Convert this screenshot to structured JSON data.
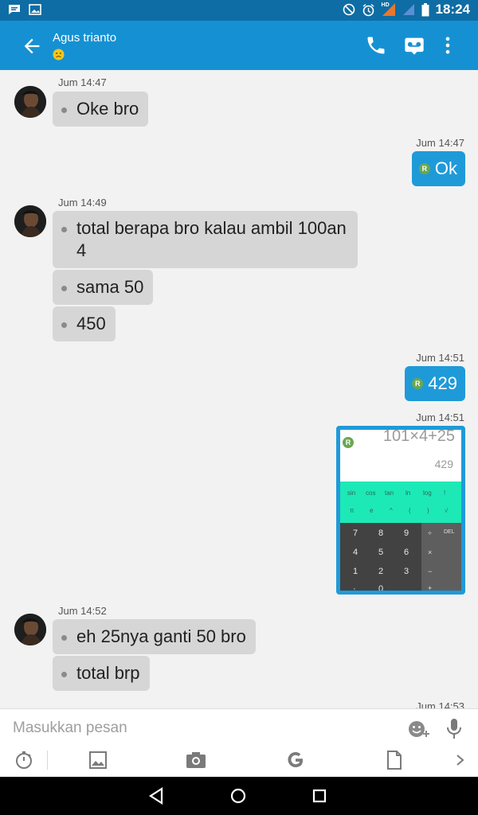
{
  "status_bar": {
    "time": "18:24",
    "network": "HD"
  },
  "header": {
    "contact_name": "Agus trianto",
    "status_icon": "sad-face-emoji",
    "accent": "#1591d3"
  },
  "messages": {
    "m1": {
      "time": "Jum 14:47",
      "text": "Oke bro"
    },
    "m2": {
      "time": "Jum 14:47",
      "text": "Ok",
      "badge": "R"
    },
    "m3": {
      "time": "Jum 14:49",
      "text1": "total berapa bro kalau ambil 100an 4",
      "text2": "sama 50",
      "text3": "450"
    },
    "m4": {
      "time": "Jum 14:51",
      "text": "429",
      "badge": "R"
    },
    "m5": {
      "time": "Jum 14:51",
      "badge": "R",
      "calc": {
        "expression": "101×4+25",
        "result": "429",
        "sci_row1": [
          "sin",
          "cos",
          "tan",
          "ln",
          "log",
          "!"
        ],
        "sci_row2": [
          "π",
          "e",
          "^",
          "(",
          ")",
          "√"
        ],
        "pad_row1": [
          "7",
          "8",
          "9"
        ],
        "pad_row2": [
          "4",
          "5",
          "6"
        ],
        "pad_row3": [
          "1",
          "2",
          "3"
        ],
        "pad_row4": [
          "·",
          "0"
        ],
        "ops": [
          "÷",
          "DEL",
          "×",
          "−",
          "+"
        ]
      }
    },
    "m6": {
      "time": "Jum 14:52",
      "text1": "eh 25nya ganti 50 bro",
      "text2": "total brp"
    },
    "m7": {
      "time": "Jum 14:53"
    }
  },
  "composer": {
    "placeholder": "Masukkan pesan"
  },
  "colors": {
    "incoming_bubble": "#d6d6d6",
    "outgoing_bubble": "#1f9ad8",
    "status_bar": "#0e6da4"
  }
}
